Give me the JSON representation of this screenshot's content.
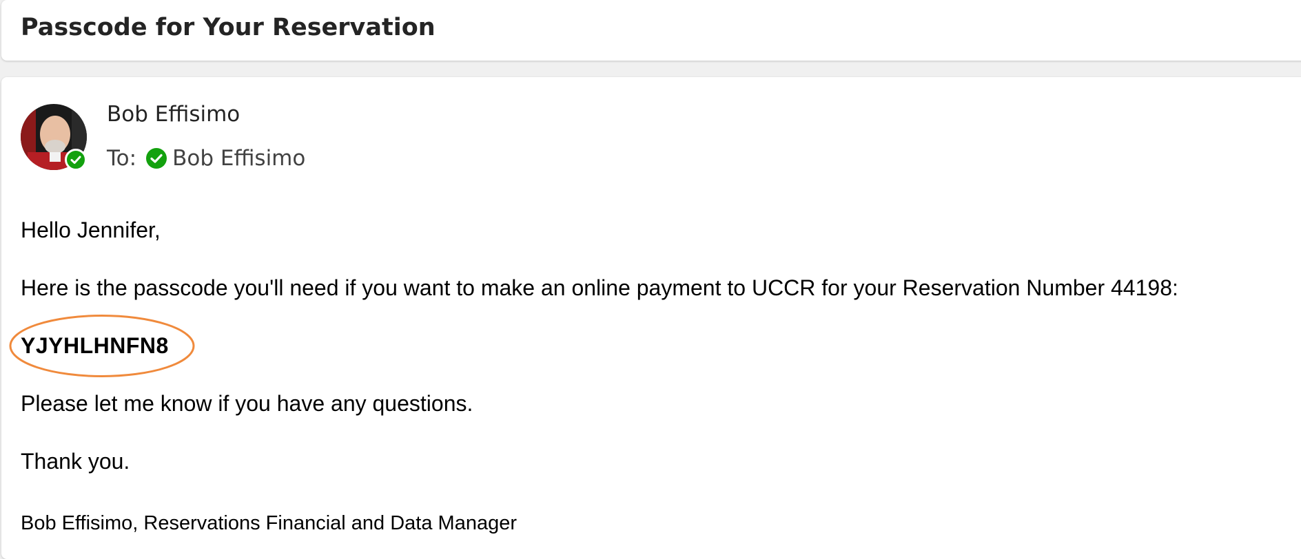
{
  "email": {
    "subject": "Passcode for Your Reservation",
    "sender": {
      "name": "Bob Effisimo",
      "status_color": "#13a10e"
    },
    "to_label": "To:",
    "recipient": "Bob Effisimo",
    "body": {
      "greeting": "Hello Jennifer,",
      "paragraph_1": "Here is the passcode you'll need if you want to make an online payment to UCCR for your Reservation Number 44198:",
      "passcode": "YJYHLHNFN8",
      "paragraph_2": "Please let me know if you have any questions.",
      "closing": "Thank you.",
      "signature": "Bob Effisimo, Reservations Financial and Data Manager"
    }
  },
  "annotation": {
    "highlight_color": "#f08a3c"
  }
}
